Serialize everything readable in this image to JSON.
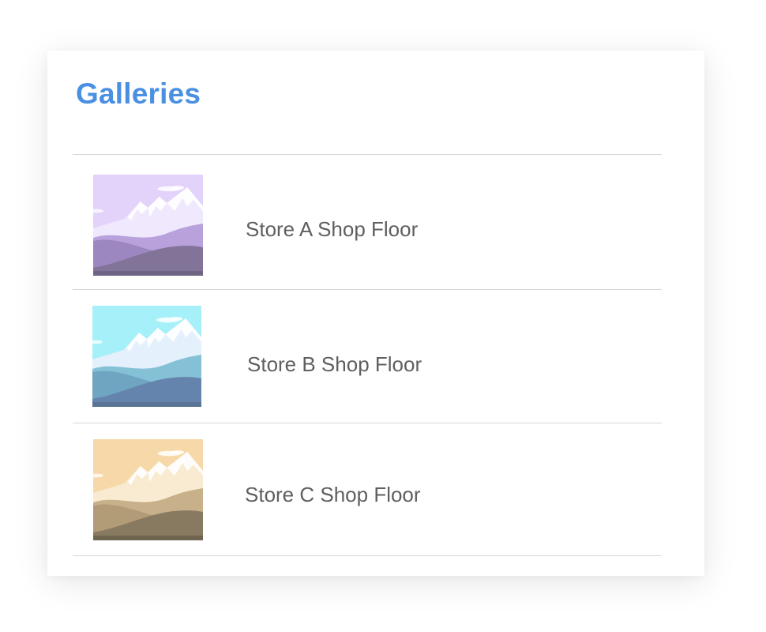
{
  "title": "Galleries",
  "galleries": [
    {
      "label": "Store A Shop Floor",
      "thumbnail_icon": "mountain-landscape-icon",
      "colors": {
        "sky": "#e3d3fb",
        "snow": "#f0e9fd",
        "mid": "#b9a1db",
        "hill": "#9d87c1",
        "front": "#827399",
        "ground": "#6f6484"
      }
    },
    {
      "label": "Store B Shop Floor",
      "thumbnail_icon": "mountain-landscape-icon",
      "colors": {
        "sky": "#a5f0f9",
        "snow": "#e4f1fc",
        "mid": "#84c1d6",
        "hill": "#6fa5c0",
        "front": "#6584ad",
        "ground": "#5a7496"
      }
    },
    {
      "label": "Store C Shop Floor",
      "thumbnail_icon": "mountain-landscape-icon",
      "colors": {
        "sky": "#f7d9a9",
        "snow": "#f8ebd2",
        "mid": "#c7b08a",
        "hill": "#b29b77",
        "front": "#877a60",
        "ground": "#6f6450"
      }
    }
  ]
}
